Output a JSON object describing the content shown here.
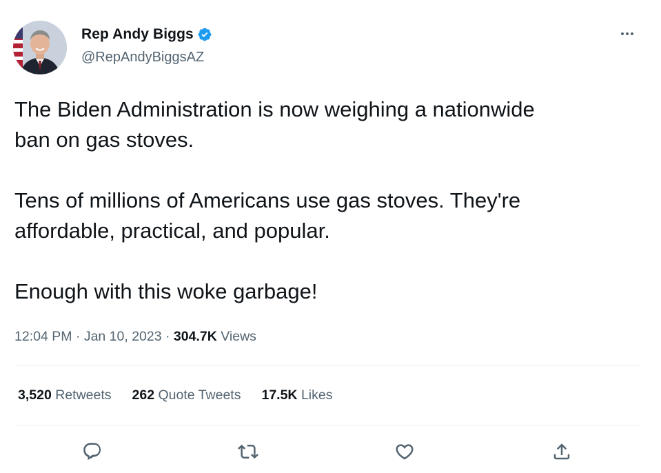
{
  "author": {
    "display_name": "Rep Andy Biggs",
    "handle": "@RepAndyBiggsAZ",
    "verified": true
  },
  "tweet": {
    "paragraphs": [
      [
        "The Biden Administration is now weighing a nationwide",
        "ban on gas stoves."
      ],
      [
        "Tens of millions of Americans use gas stoves. They're",
        "affordable, practical, and popular."
      ],
      [
        "Enough with this woke garbage!"
      ]
    ],
    "time": "12:04 PM",
    "date": "Jan 10, 2023",
    "separator": "·",
    "views_count": "304.7K",
    "views_label": "Views"
  },
  "stats": {
    "retweets_count": "3,520",
    "retweets_label": "Retweets",
    "quotes_count": "262",
    "quotes_label": "Quote Tweets",
    "likes_count": "17.5K",
    "likes_label": "Likes"
  },
  "actions": [
    "reply-icon",
    "retweet-icon",
    "like-icon",
    "share-icon"
  ],
  "colors": {
    "text_primary": "#0f1419",
    "text_secondary": "#536471",
    "verified_blue": "#1d9bf0",
    "divider": "#eff3f4"
  }
}
